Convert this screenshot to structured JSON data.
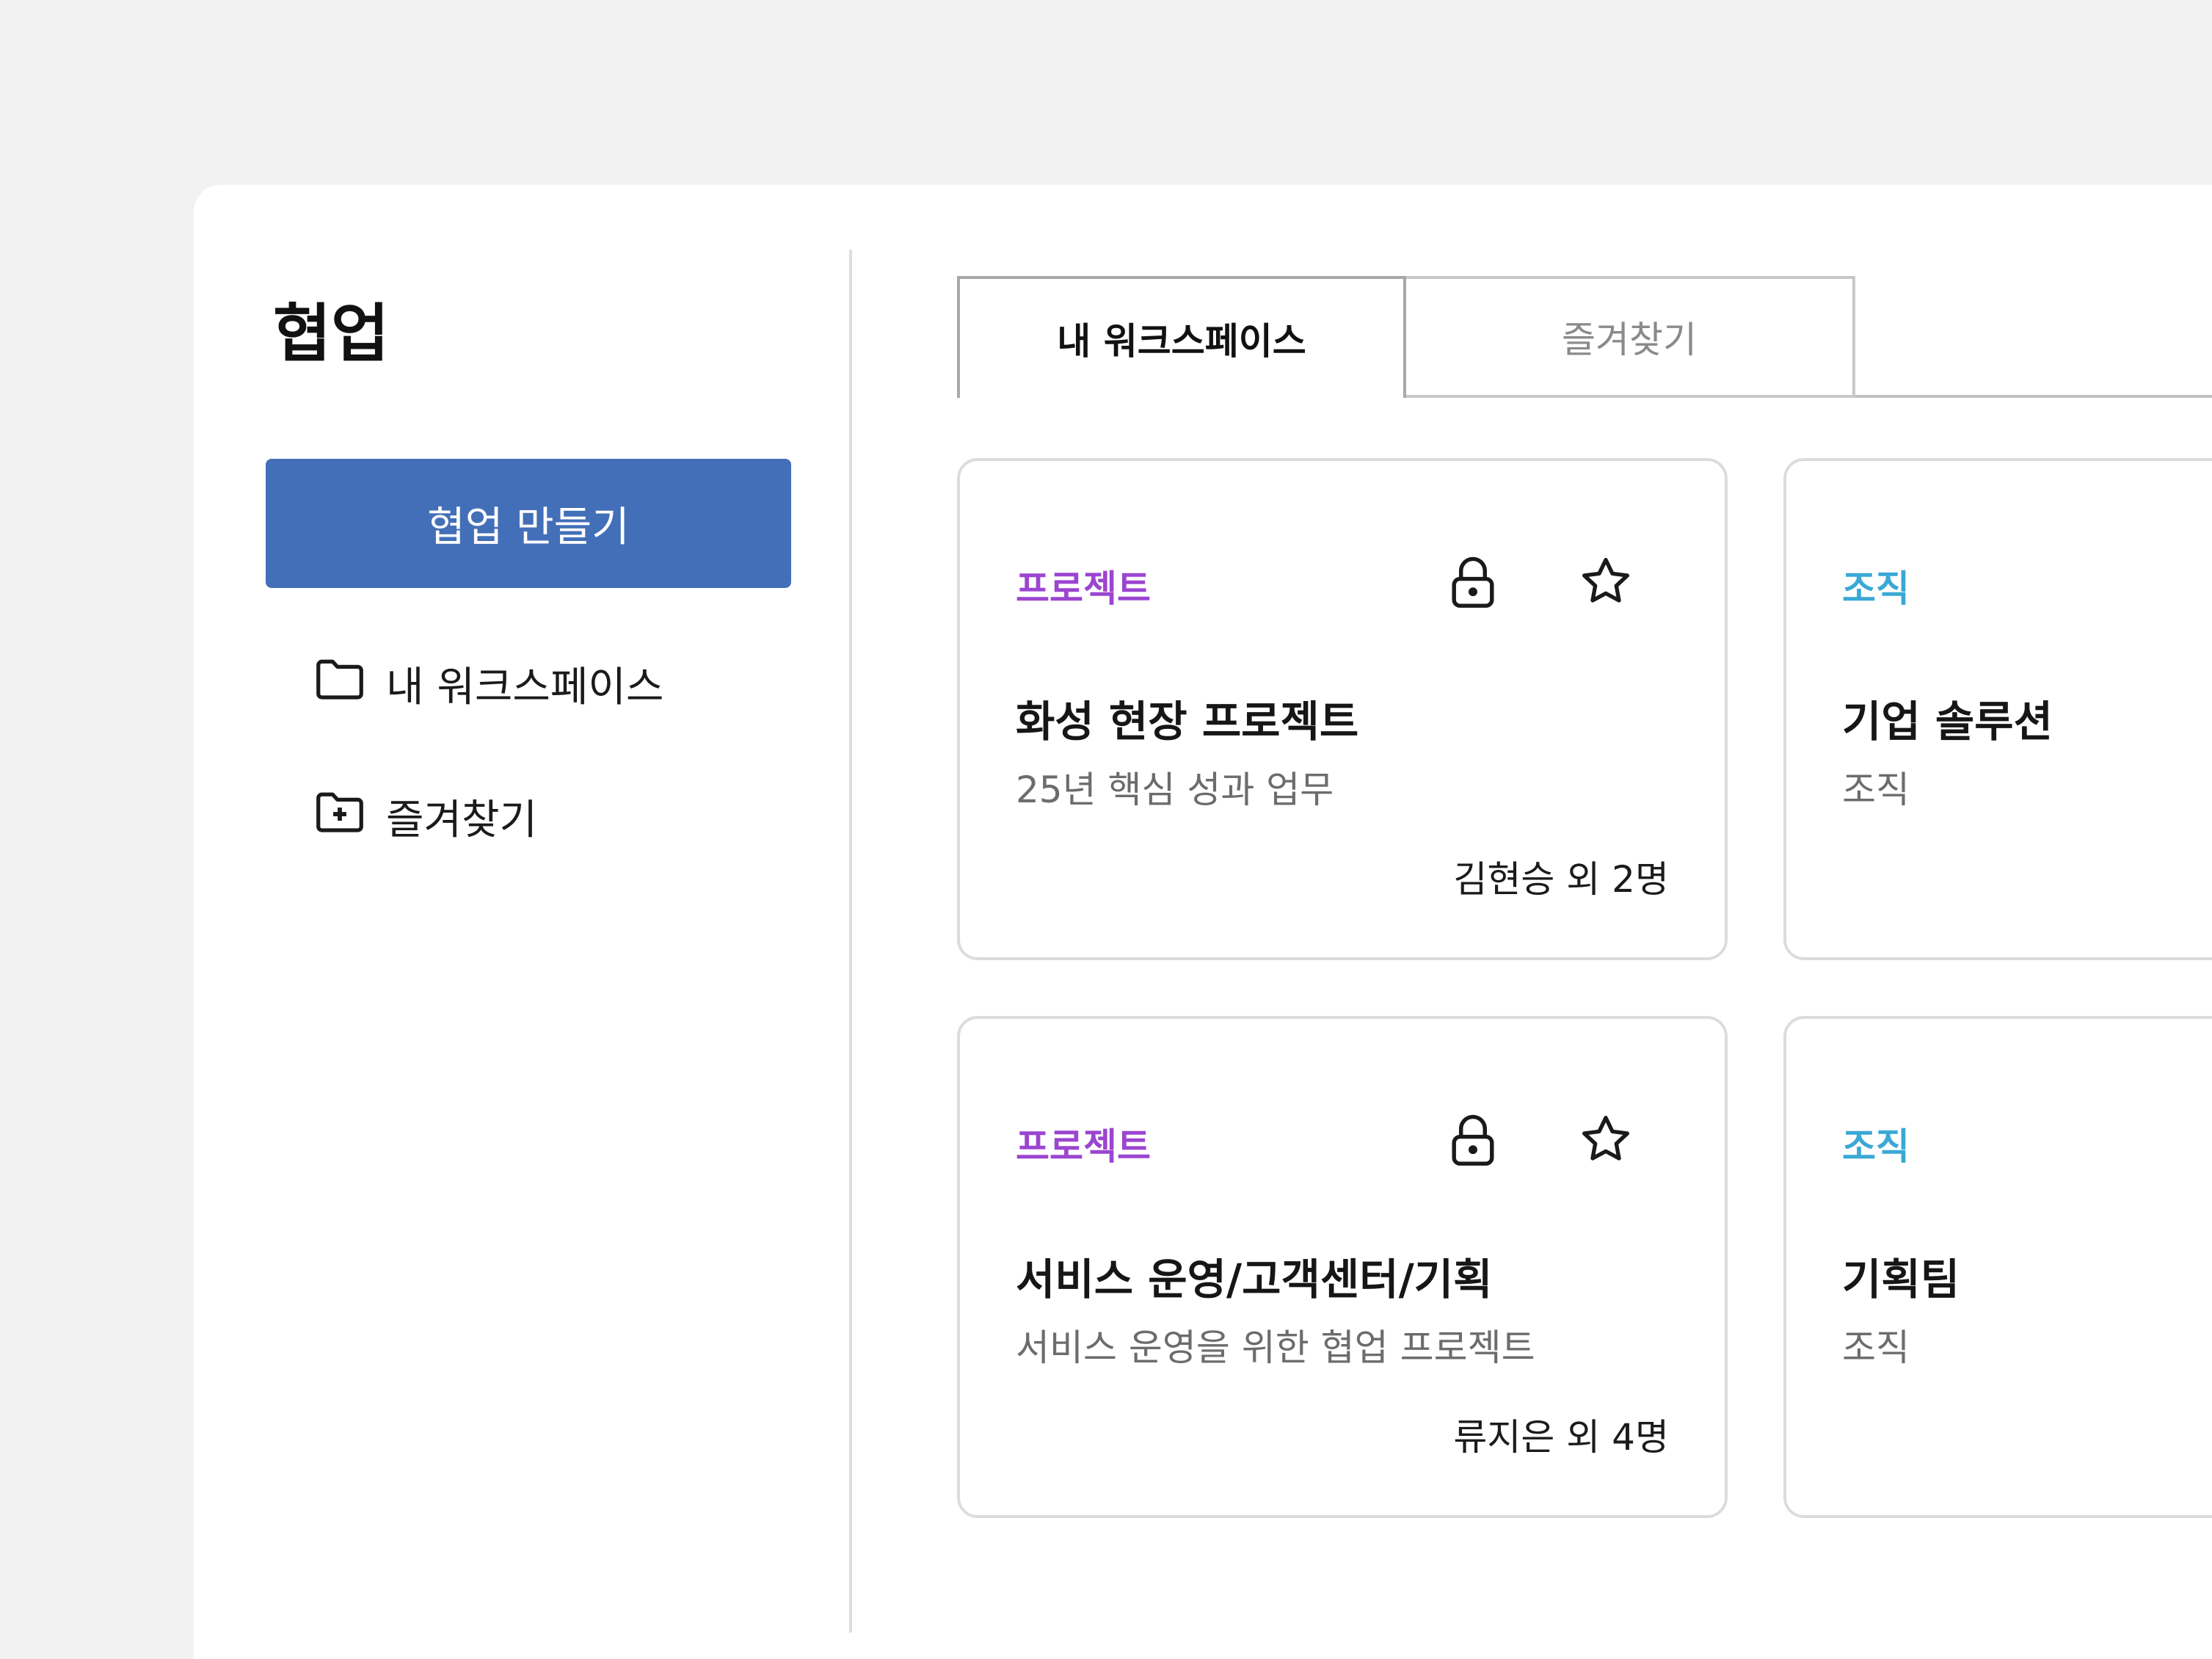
{
  "sidebar": {
    "title": "협업",
    "create_label": "협업 만들기",
    "items": [
      {
        "label": "내 워크스페이스",
        "icon": "folder-icon"
      },
      {
        "label": "즐겨찾기",
        "icon": "folder-plus-icon"
      }
    ]
  },
  "tabs": [
    {
      "label": "내 워크스페이스",
      "active": true
    },
    {
      "label": "즐겨찾기",
      "active": false
    }
  ],
  "cards": [
    {
      "tag": "프로젝트",
      "title": "화성 현장 프로젝트",
      "desc": "25년 핵심 성과 업무",
      "members": "김현승 외 2명",
      "tag_color": "#9b45d0"
    },
    {
      "tag": "조직",
      "title": "기업 솔루션",
      "desc": "조직",
      "tag_color": "#3aa8d6"
    },
    {
      "tag": "프로젝트",
      "title": "서비스 운영/고객센터/기획",
      "desc": "서비스 운영을 위한 협업 프로젝트",
      "members": "류지은 외 4명",
      "tag_color": "#9b45d0"
    },
    {
      "tag": "조직",
      "title": "기획팀",
      "desc": "조직",
      "tag_color": "#3aa8d6"
    }
  ],
  "colors": {
    "accent": "#426fb8",
    "background": "#f2f2f2",
    "panel": "#ffffff"
  }
}
